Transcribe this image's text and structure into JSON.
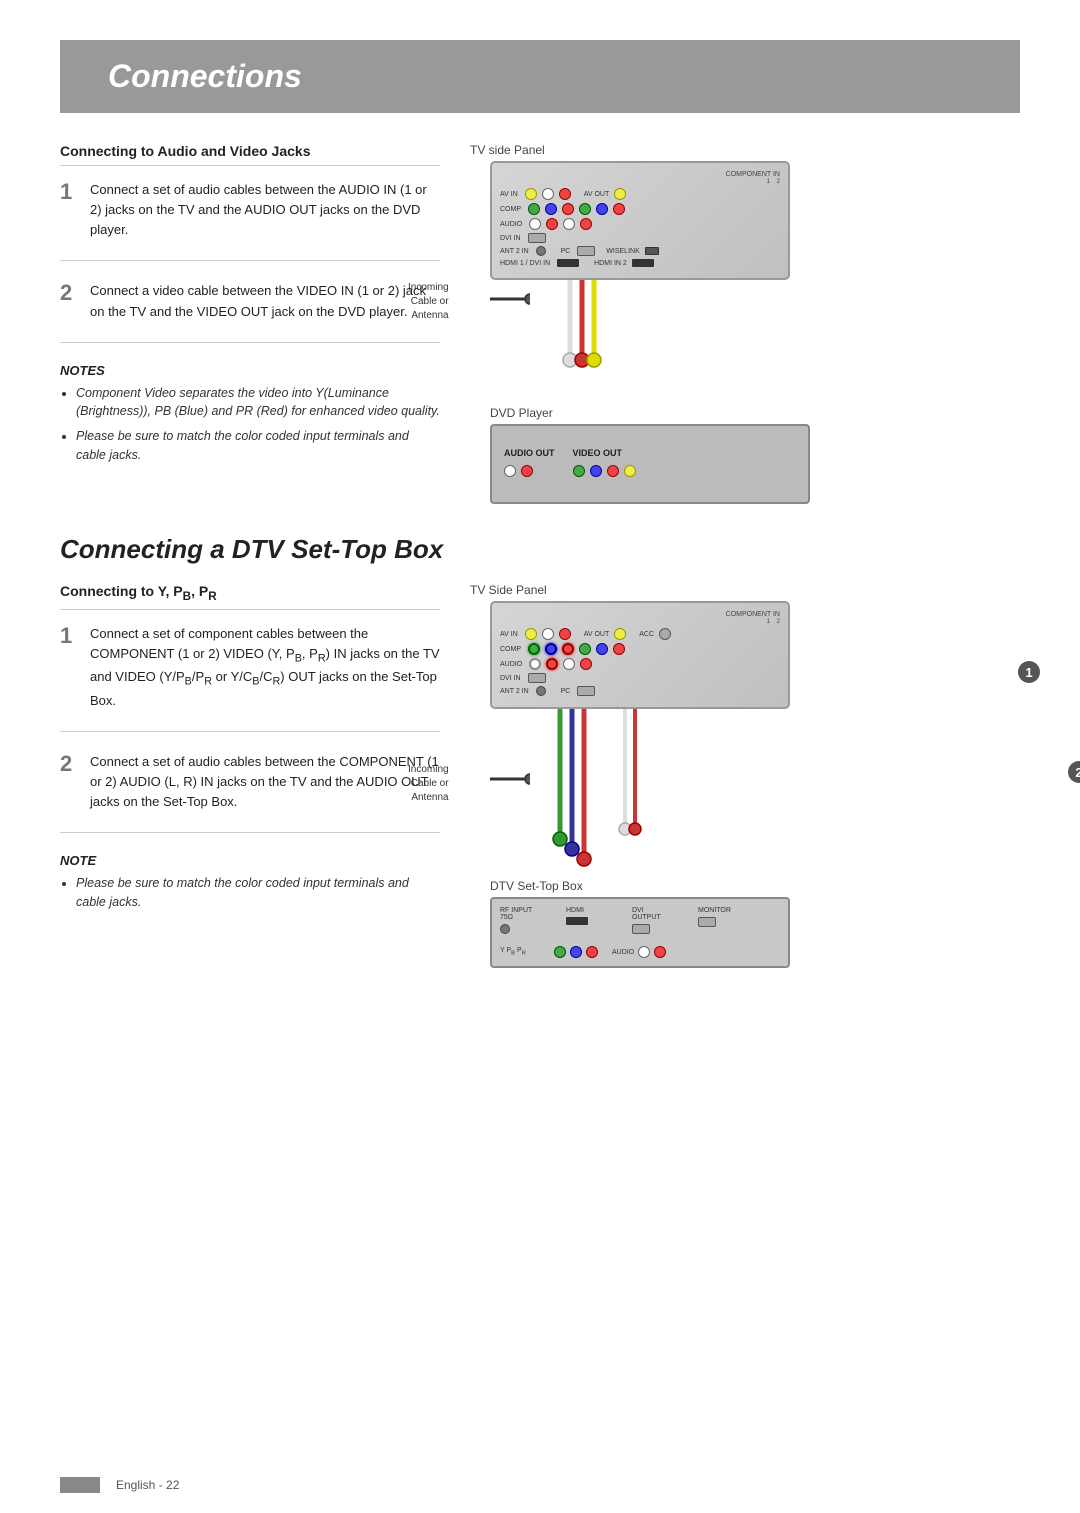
{
  "page": {
    "title": "Connections",
    "footer_bar_label": "",
    "footer_text": "English - 22"
  },
  "section1": {
    "heading": "Connecting to Audio and Video Jacks",
    "diagram_label_top": "TV side Panel",
    "diagram_label_bottom": "DVD Player",
    "step1": {
      "number": "1",
      "text": "Connect a set of audio cables between the AUDIO IN (1 or 2) jacks on the TV and the AUDIO OUT jacks on the DVD player."
    },
    "step2": {
      "number": "2",
      "text": "Connect a video cable between the VIDEO IN (1 or 2) jack on the TV and the VIDEO OUT jack on the DVD player."
    },
    "notes": {
      "title": "NOTES",
      "items": [
        "Component Video separates the video into Y(Luminance (Brightness)), PB (Blue) and PR (Red) for enhanced video quality.",
        "Please be sure to match the color coded input terminals and cable jacks."
      ]
    }
  },
  "section2": {
    "major_heading": "Connecting a DTV Set-Top Box",
    "subheading": "Connecting to Y, PB, PR",
    "diagram_label_top": "TV Side Panel",
    "diagram_label_bottom": "DTV Set-Top Box",
    "step1": {
      "number": "1",
      "text": "Connect a set of component cables between the COMPONENT (1 or 2) VIDEO (Y, PB, PR) IN jacks on the TV and VIDEO (Y/PB/PR or Y/CB/CR) OUT jacks on the Set-Top Box."
    },
    "step2": {
      "number": "2",
      "text": "Connect a set of audio cables between the COMPONENT (1 or 2) AUDIO (L, R) IN jacks on the TV and the AUDIO OUT jacks on the Set-Top Box."
    },
    "note": {
      "title": "NOTE",
      "items": [
        "Please be sure to match the color coded input terminals and cable jacks."
      ]
    },
    "incoming_label": "Incoming\nCable or\nAntenna"
  }
}
